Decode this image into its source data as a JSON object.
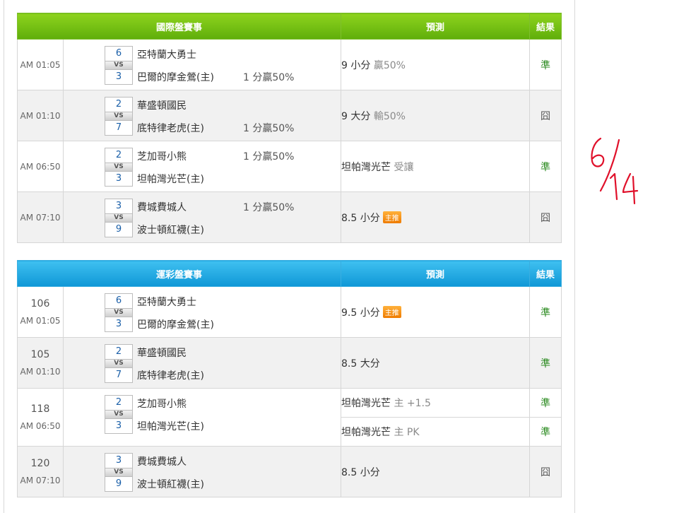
{
  "intl": {
    "header": {
      "event": "國際盤賽事",
      "prediction": "預測",
      "result": "結果"
    },
    "rows": [
      {
        "time": "AM 01:05",
        "away": {
          "score": "6",
          "team": "亞特蘭大勇士"
        },
        "home": {
          "score": "3",
          "team": "巴爾的摩金鶯(主)"
        },
        "vs": "VS",
        "handicap": "1 分贏50%",
        "handicap_row": "home",
        "pred_main": "9 小分",
        "pred_sub": "贏50%",
        "badge": "",
        "result": "準",
        "result_type": "win"
      },
      {
        "time": "AM 01:10",
        "away": {
          "score": "2",
          "team": "華盛頓國民"
        },
        "home": {
          "score": "7",
          "team": "底特律老虎(主)"
        },
        "vs": "VS",
        "handicap": "1 分贏50%",
        "handicap_row": "home",
        "pred_main": "9 大分",
        "pred_sub": "輸50%",
        "badge": "",
        "result": "囧",
        "result_type": "lose"
      },
      {
        "time": "AM 06:50",
        "away": {
          "score": "2",
          "team": "芝加哥小熊"
        },
        "home": {
          "score": "3",
          "team": "坦帕灣光芒(主)"
        },
        "vs": "VS",
        "handicap": "1 分贏50%",
        "handicap_row": "away",
        "pred_main": "坦帕灣光芒",
        "pred_sub": "受讓",
        "badge": "",
        "result": "準",
        "result_type": "win"
      },
      {
        "time": "AM 07:10",
        "away": {
          "score": "3",
          "team": "費城費城人"
        },
        "home": {
          "score": "9",
          "team": "波士頓紅襪(主)"
        },
        "vs": "VS",
        "handicap": "1 分贏50%",
        "handicap_row": "away",
        "pred_main": "8.5 小分",
        "pred_sub": "",
        "badge": "主推",
        "result": "囧",
        "result_type": "lose"
      }
    ]
  },
  "sport": {
    "header": {
      "event": "運彩盤賽事",
      "prediction": "預測",
      "result": "結果"
    },
    "rows": [
      {
        "num": "106",
        "time": "AM 01:05",
        "away": {
          "score": "6",
          "team": "亞特蘭大勇士"
        },
        "home": {
          "score": "3",
          "team": "巴爾的摩金鶯(主)"
        },
        "vs": "VS",
        "preds": [
          {
            "main": "9.5 小分",
            "sub": "",
            "badge": "主推",
            "result": "準",
            "result_type": "win"
          }
        ]
      },
      {
        "num": "105",
        "time": "AM 01:10",
        "away": {
          "score": "2",
          "team": "華盛頓國民"
        },
        "home": {
          "score": "7",
          "team": "底特律老虎(主)"
        },
        "vs": "VS",
        "preds": [
          {
            "main": "8.5 大分",
            "sub": "",
            "badge": "",
            "result": "準",
            "result_type": "win"
          }
        ]
      },
      {
        "num": "118",
        "time": "AM 06:50",
        "away": {
          "score": "2",
          "team": "芝加哥小熊"
        },
        "home": {
          "score": "3",
          "team": "坦帕灣光芒(主)"
        },
        "vs": "VS",
        "preds": [
          {
            "main": "坦帕灣光芒",
            "sub": "主 +1.5",
            "badge": "",
            "result": "準",
            "result_type": "win"
          },
          {
            "main": "坦帕灣光芒",
            "sub": "主 PK",
            "badge": "",
            "result": "準",
            "result_type": "win"
          }
        ]
      },
      {
        "num": "120",
        "time": "AM 07:10",
        "away": {
          "score": "3",
          "team": "費城費城人"
        },
        "home": {
          "score": "9",
          "team": "波士頓紅襪(主)"
        },
        "vs": "VS",
        "preds": [
          {
            "main": "8.5 小分",
            "sub": "",
            "badge": "",
            "result": "囧",
            "result_type": "lose"
          }
        ]
      }
    ]
  },
  "annotation": {
    "text": "6/14",
    "color": "#e0102a"
  }
}
